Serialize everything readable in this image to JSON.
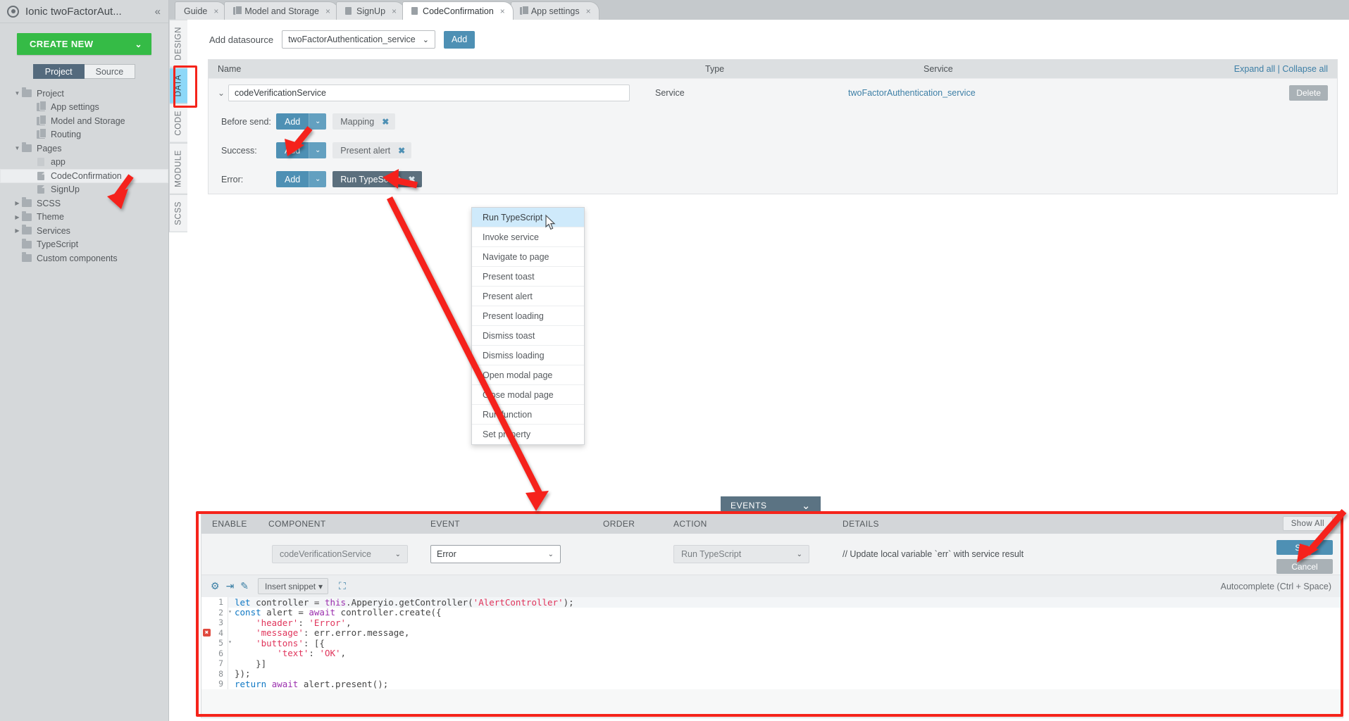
{
  "sidebar": {
    "project_name": "Ionic twoFactorAut...",
    "collapse_icon": "«",
    "create_new_label": "CREATE NEW",
    "create_new_chevron": "⌄",
    "tabs": [
      {
        "label": "Project",
        "active": true
      },
      {
        "label": "Source",
        "active": false
      }
    ],
    "tree": [
      {
        "label": "Project",
        "icon": "folder",
        "depth": 0,
        "twisty": "▼",
        "selected": false
      },
      {
        "label": "App settings",
        "icon": "component",
        "depth": 1,
        "twisty": "",
        "selected": false
      },
      {
        "label": "Model and Storage",
        "icon": "component",
        "depth": 1,
        "twisty": "",
        "selected": false
      },
      {
        "label": "Routing",
        "icon": "component",
        "depth": 1,
        "twisty": "",
        "selected": false
      },
      {
        "label": "Pages",
        "icon": "folder",
        "depth": 0,
        "twisty": "▼",
        "selected": false
      },
      {
        "label": "app",
        "icon": "page-light",
        "depth": 1,
        "twisty": "",
        "selected": false
      },
      {
        "label": "CodeConfirmation",
        "icon": "page",
        "depth": 1,
        "twisty": "",
        "selected": true
      },
      {
        "label": "SignUp",
        "icon": "page",
        "depth": 1,
        "twisty": "",
        "selected": false
      },
      {
        "label": "SCSS",
        "icon": "folder",
        "depth": 0,
        "twisty": "▶",
        "selected": false
      },
      {
        "label": "Theme",
        "icon": "folder",
        "depth": 0,
        "twisty": "▶",
        "selected": false
      },
      {
        "label": "Services",
        "icon": "folder",
        "depth": 0,
        "twisty": "▶",
        "selected": false
      },
      {
        "label": "TypeScript",
        "icon": "folder",
        "depth": 0,
        "twisty": "",
        "selected": false
      },
      {
        "label": "Custom components",
        "icon": "folder",
        "depth": 0,
        "twisty": "",
        "selected": false
      }
    ]
  },
  "editor_tabs": [
    {
      "label": "Guide",
      "icon": "none",
      "active": false,
      "close": "×"
    },
    {
      "label": "Model and Storage",
      "icon": "component",
      "active": false,
      "close": "×"
    },
    {
      "label": "SignUp",
      "icon": "page",
      "active": false,
      "close": "×"
    },
    {
      "label": "CodeConfirmation",
      "icon": "page",
      "active": true,
      "close": "×"
    },
    {
      "label": "App settings",
      "icon": "component",
      "active": false,
      "close": "×"
    }
  ],
  "vertical_tabs": [
    {
      "label": "DESIGN",
      "active": false
    },
    {
      "label": "DATA",
      "active": true
    },
    {
      "label": "CODE",
      "active": false
    },
    {
      "label": "MODULE",
      "active": false
    },
    {
      "label": "SCSS",
      "active": false
    }
  ],
  "datasource_bar": {
    "label": "Add datasource",
    "selected_value": "twoFactorAuthentication_service",
    "chevron": "⌄",
    "add_label": "Add"
  },
  "datasource_table": {
    "headers": {
      "name": "Name",
      "type": "Type",
      "service": "Service"
    },
    "expand_all": "Expand all",
    "separator": "|",
    "collapse_all": "Collapse all",
    "row": {
      "caret": "⌄",
      "name_value": "codeVerificationService",
      "type": "Service",
      "service": "twoFactorAuthentication_service",
      "delete_label": "Delete"
    },
    "handlers": [
      {
        "label": "Before send:",
        "add": "Add",
        "chevron": "⌄",
        "chip": "Mapping",
        "chip_close": "✖",
        "chip_dark": false
      },
      {
        "label": "Success:",
        "add": "Add",
        "chevron": "⌄",
        "chip": "Present alert",
        "chip_close": "✖",
        "chip_dark": false
      },
      {
        "label": "Error:",
        "add": "Add",
        "chevron": "⌄",
        "chip": "Run TypeScript",
        "chip_close": "✖",
        "chip_dark": true
      }
    ]
  },
  "action_dropdown": {
    "items": [
      {
        "label": "Run TypeScript",
        "highlighted": true
      },
      {
        "label": "Invoke service",
        "highlighted": false
      },
      {
        "label": "Navigate to page",
        "highlighted": false
      },
      {
        "label": "Present toast",
        "highlighted": false
      },
      {
        "label": "Present alert",
        "highlighted": false
      },
      {
        "label": "Present loading",
        "highlighted": false
      },
      {
        "label": "Dismiss toast",
        "highlighted": false
      },
      {
        "label": "Dismiss loading",
        "highlighted": false
      },
      {
        "label": "Open modal page",
        "highlighted": false
      },
      {
        "label": "Close modal page",
        "highlighted": false
      },
      {
        "label": "Run function",
        "highlighted": false
      },
      {
        "label": "Set property",
        "highlighted": false
      }
    ]
  },
  "events_panel": {
    "tab_label": "EVENTS",
    "tab_chevron": "⌄",
    "headers": {
      "enable": "ENABLE",
      "component": "COMPONENT",
      "event": "EVENT",
      "order": "ORDER",
      "action": "ACTION",
      "details": "DETAILS"
    },
    "show_all": "Show All",
    "row": {
      "component": "codeVerificationService",
      "component_chevron": "⌄",
      "event": "Error",
      "event_chevron": "⌄",
      "order": "",
      "action": "Run TypeScript",
      "action_chevron": "⌄",
      "details": "// Update local variable `err` with service result"
    },
    "save_label": "Save",
    "cancel_label": "Cancel"
  },
  "code_editor": {
    "toolbar": {
      "settings_icon": "⚙",
      "format_icon": "⇥",
      "wand_icon": "✎",
      "snippet_label": "Insert snippet",
      "snippet_chevron": "▾",
      "fullscreen_icon": "⛶",
      "autocomplete_hint": "Autocomplete (Ctrl + Space)"
    },
    "lines": [
      {
        "num": "1",
        "fold": "",
        "error": false,
        "text": "let controller = this.Apperyio.getController('AlertController');"
      },
      {
        "num": "2",
        "fold": "▾",
        "error": false,
        "text": "const alert = await controller.create({"
      },
      {
        "num": "3",
        "fold": "",
        "error": false,
        "text": "    'header': 'Error',"
      },
      {
        "num": "4",
        "fold": "",
        "error": true,
        "text": "    'message': err.error.message,"
      },
      {
        "num": "5",
        "fold": "▾",
        "error": false,
        "text": "    'buttons': [{"
      },
      {
        "num": "6",
        "fold": "",
        "error": false,
        "text": "        'text': 'OK',"
      },
      {
        "num": "7",
        "fold": "",
        "error": false,
        "text": "    }]"
      },
      {
        "num": "8",
        "fold": "",
        "error": false,
        "text": "});"
      },
      {
        "num": "9",
        "fold": "",
        "error": false,
        "text": "return await alert.present();"
      }
    ],
    "error_marker": "✖"
  },
  "colors": {
    "accent_blue": "#4e90b4",
    "green": "#35bb46",
    "annotation_red": "#f5241b",
    "active_tab_blue": "#8ed8f8",
    "dark_chip": "#5b6f7d"
  }
}
